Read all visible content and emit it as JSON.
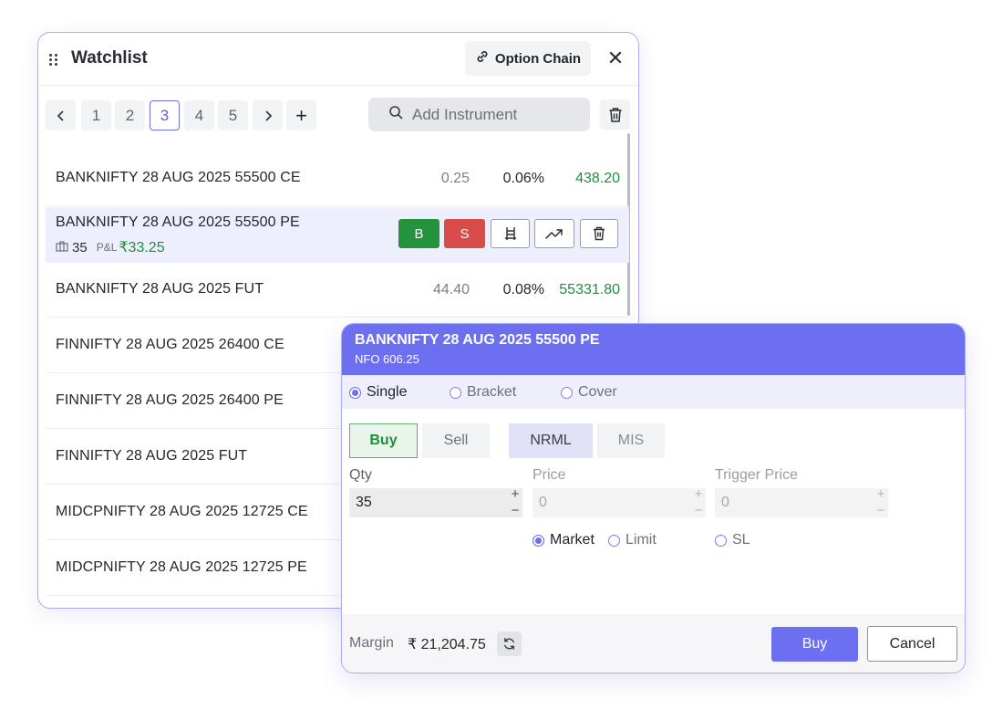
{
  "watchlist": {
    "title": "Watchlist",
    "option_chain_label": "Option Chain",
    "pages": [
      "1",
      "2",
      "3",
      "4",
      "5"
    ],
    "active_page": "3",
    "add_page_label": "+",
    "search_placeholder": "Add Instrument",
    "rows": [
      {
        "symbol": "BANKNIFTY 28 AUG 2025 55500 CE",
        "change": "0.25",
        "percent": "0.06%",
        "ltp": "438.20"
      },
      {
        "symbol": "BANKNIFTY 28 AUG 2025 55500 PE",
        "qty": "35",
        "pl_label": "P&L",
        "pl_value": "₹33.25",
        "buy_label": "B",
        "sell_label": "S"
      },
      {
        "symbol": "BANKNIFTY 28 AUG 2025 FUT",
        "change": "44.40",
        "percent": "0.08%",
        "ltp": "55331.80"
      },
      {
        "symbol": "FINNIFTY 28 AUG 2025 26400 CE"
      },
      {
        "symbol": "FINNIFTY 28 AUG 2025 26400 PE"
      },
      {
        "symbol": "FINNIFTY 28 AUG 2025 FUT"
      },
      {
        "symbol": "MIDCPNIFTY 28 AUG 2025 12725 CE"
      },
      {
        "symbol": "MIDCPNIFTY 28 AUG 2025 12725 PE"
      }
    ]
  },
  "order": {
    "title": "BANKNIFTY 28 AUG 2025 55500 PE",
    "subtitle": "NFO 606.25",
    "variety": {
      "options": [
        "Single",
        "Bracket",
        "Cover"
      ],
      "selected": "Single"
    },
    "side": {
      "buy": "Buy",
      "sell": "Sell",
      "selected": "Buy"
    },
    "product": {
      "nrml": "NRML",
      "mis": "MIS",
      "selected": "NRML"
    },
    "qty": {
      "label": "Qty",
      "value": "35"
    },
    "price": {
      "label": "Price",
      "value": "0"
    },
    "trigger": {
      "label": "Trigger Price",
      "value": "0"
    },
    "order_type": {
      "options": [
        "Market",
        "Limit",
        "SL"
      ],
      "selected": "Market"
    },
    "stepper_plus": "+",
    "stepper_minus": "−",
    "margin_label": "Margin",
    "margin_value": "₹ 21,204.75",
    "submit_label": "Buy",
    "cancel_label": "Cancel"
  },
  "colors": {
    "accent": "#6b6ff0",
    "buy_green": "#25923e",
    "sell_red": "#d94c4c",
    "positive_text": "#1f8f3a"
  },
  "icons": [
    "drag-handle-icon",
    "link-icon",
    "close-icon",
    "chevron-left-icon",
    "chevron-right-icon",
    "search-icon",
    "trash-icon",
    "holdings-icon",
    "market-depth-icon",
    "chart-icon",
    "refresh-icon"
  ]
}
